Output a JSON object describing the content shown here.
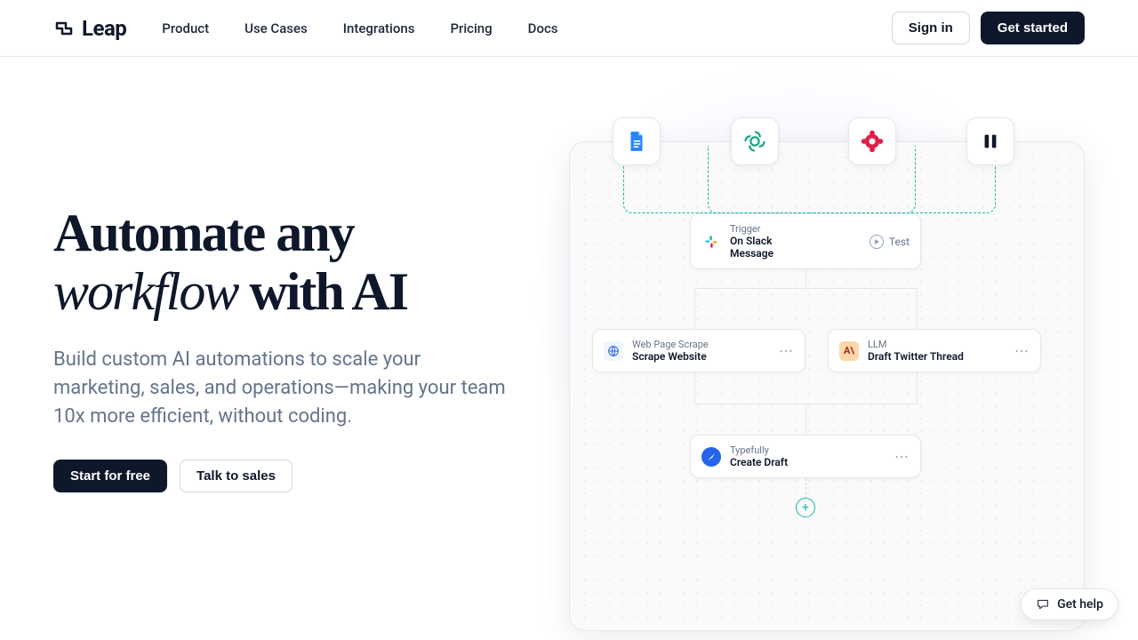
{
  "brand": "Leap",
  "nav": {
    "items": [
      "Product",
      "Use Cases",
      "Integrations",
      "Pricing",
      "Docs"
    ]
  },
  "header_actions": {
    "signin": "Sign in",
    "get_started": "Get started"
  },
  "hero": {
    "title_part1": "Automate any",
    "title_italic": "workflow",
    "title_part2": " with AI",
    "subtitle": "Build custom AI automations to scale your marketing, sales, and operations—making your team 10x more efficient, without coding.",
    "cta_primary": "Start for free",
    "cta_secondary": "Talk to sales"
  },
  "workflow": {
    "trigger": {
      "label": "Trigger",
      "action": "On Slack Message",
      "test": "Test"
    },
    "scrape": {
      "label": "Web Page Scrape",
      "action": "Scrape Website"
    },
    "llm": {
      "label": "LLM",
      "action": "Draft Twitter Thread"
    },
    "typefully": {
      "label": "Typefully",
      "action": "Create Draft"
    }
  },
  "tools": [
    "google-doc-icon",
    "openai-icon",
    "red-hub-icon",
    "pause-icon"
  ],
  "help": "Get help"
}
